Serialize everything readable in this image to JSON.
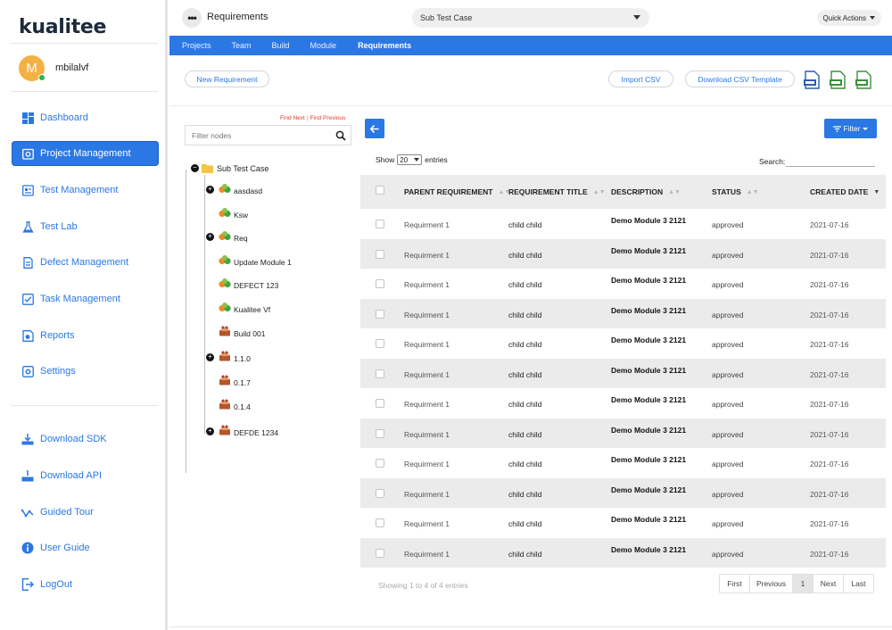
{
  "app": {
    "logo": "kualitee"
  },
  "user": {
    "initial": "M",
    "name": "mbilalvf"
  },
  "sidebar": {
    "items": [
      {
        "label": "Dashboard",
        "icon": "dashboard-icon"
      },
      {
        "label": "Project Management",
        "icon": "project-icon",
        "active": true
      },
      {
        "label": "Test Management",
        "icon": "test-icon"
      },
      {
        "label": "Test Lab",
        "icon": "flask-icon"
      },
      {
        "label": "Defect Management",
        "icon": "defect-icon"
      },
      {
        "label": "Task Management",
        "icon": "task-icon"
      },
      {
        "label": "Reports",
        "icon": "reports-icon"
      },
      {
        "label": "Settings",
        "icon": "gear-icon"
      }
    ],
    "bottom_items": [
      {
        "label": "Download SDK",
        "icon": "download-sdk-icon"
      },
      {
        "label": "Download API",
        "icon": "download-api-icon"
      },
      {
        "label": "Guided Tour",
        "icon": "tour-icon"
      },
      {
        "label": "User Guide",
        "icon": "info-icon"
      },
      {
        "label": "LogOut",
        "icon": "logout-icon"
      }
    ]
  },
  "header": {
    "title": "Requirements",
    "selector_value": "Sub Test Case",
    "quick_actions": "Quick Actions"
  },
  "tabs": [
    {
      "label": "Projects"
    },
    {
      "label": "Team"
    },
    {
      "label": "Build"
    },
    {
      "label": "Module"
    },
    {
      "label": "Requirements",
      "active": true
    }
  ],
  "actions": {
    "new_requirement": "New Requirement",
    "import_csv": "Import CSV",
    "download_template": "Download CSV Template"
  },
  "tree": {
    "find_next": "Find Next",
    "find_previous": "Find Previous",
    "filter_placeholder": "Filter nodes",
    "root": "Sub Test Case",
    "nodes": [
      {
        "label": "aasdasd",
        "expandable": true,
        "kind": "module"
      },
      {
        "label": "Ksw",
        "expandable": false,
        "kind": "module"
      },
      {
        "label": "Req",
        "expandable": true,
        "kind": "module"
      },
      {
        "label": "Update Module 1",
        "expandable": false,
        "kind": "module"
      },
      {
        "label": "DEFECT 123",
        "expandable": false,
        "kind": "module"
      },
      {
        "label": "Kualitee Vf",
        "expandable": false,
        "kind": "module"
      },
      {
        "label": "Build 001",
        "expandable": false,
        "kind": "build"
      },
      {
        "label": "1.1.0",
        "expandable": true,
        "kind": "build"
      },
      {
        "label": "0.1.7",
        "expandable": false,
        "kind": "build"
      },
      {
        "label": "0.1.4",
        "expandable": false,
        "kind": "build"
      },
      {
        "label": "DEFDE 1234",
        "expandable": true,
        "kind": "build"
      }
    ]
  },
  "table_controls": {
    "filter": "Filter",
    "show": "Show",
    "entries_value": "20",
    "entries": "entries",
    "search": "Search:"
  },
  "table": {
    "headers": [
      "PARENT REQUIREMENT",
      "REQUIREMENT TITLE",
      "DESCRIPTION",
      "STATUS",
      "CREATED DATE"
    ],
    "rows": [
      [
        "Requirment 1",
        "child child",
        "Demo Module 3 2121",
        "approved",
        "2021-07-16"
      ],
      [
        "Requirment 1",
        "child child",
        "Demo Module 3 2121",
        "approved",
        "2021-07-16"
      ],
      [
        "Requirment 1",
        "child child",
        "Demo Module 3 2121",
        "approved",
        "2021-07-16"
      ],
      [
        "Requirment 1",
        "child child",
        "Demo Module 3 2121",
        "approved",
        "2021-07-16"
      ],
      [
        "Requirment 1",
        "child child",
        "Demo Module 3 2121",
        "approved",
        "2021-07-16"
      ],
      [
        "Requirment 1",
        "child child",
        "Demo Module 3 2121",
        "approved",
        "2021-07-16"
      ],
      [
        "Requirment 1",
        "child child",
        "Demo Module 3 2121",
        "approved",
        "2021-07-16"
      ],
      [
        "Requirment 1",
        "child child",
        "Demo Module 3 2121",
        "approved",
        "2021-07-16"
      ],
      [
        "Requirment 1",
        "child child",
        "Demo Module 3 2121",
        "approved",
        "2021-07-16"
      ],
      [
        "Requirment 1",
        "child child",
        "Demo Module 3 2121",
        "approved",
        "2021-07-16"
      ],
      [
        "Requirment 1",
        "child child",
        "Demo Module 3 2121",
        "approved",
        "2021-07-16"
      ],
      [
        "Requirment 1",
        "child child",
        "Demo Module 3 2121",
        "approved",
        "2021-07-16"
      ]
    ]
  },
  "footer": {
    "showing": "Showing 1 to 4 of 4 entries",
    "pager": [
      "First",
      "Previous",
      "1",
      "Next",
      "Last"
    ]
  },
  "colors": {
    "accent": "#2b78e4",
    "row_alt": "#ebebeb",
    "find_link": "#e23a2b"
  }
}
